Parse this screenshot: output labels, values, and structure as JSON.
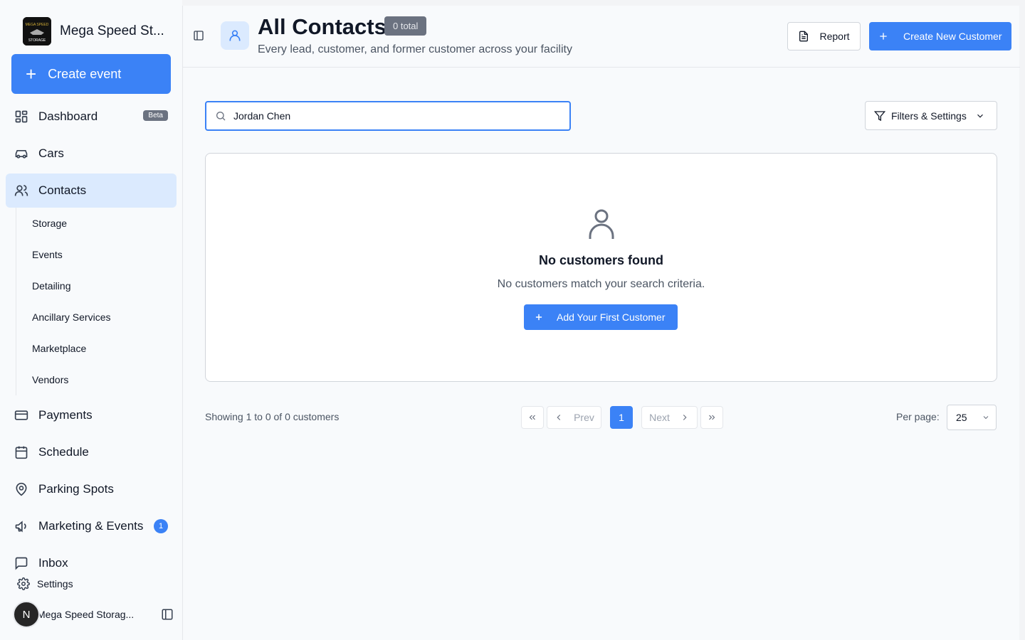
{
  "sidebar": {
    "brand_name": "Mega Speed St...",
    "brand_logo_text": "MEGA SPEED STORAGE",
    "create_event_label": "Create event",
    "nav": {
      "dashboard": "Dashboard",
      "dashboard_badge": "Beta",
      "cars": "Cars",
      "contacts": "Contacts",
      "payments": "Payments",
      "schedule": "Schedule",
      "parking_spots": "Parking Spots",
      "marketing_events": "Marketing & Events",
      "marketing_count": "1",
      "inbox": "Inbox"
    },
    "sub_items": [
      "Storage",
      "Events",
      "Detailing",
      "Ancillary Services",
      "Marketplace",
      "Vendors"
    ],
    "settings_label": "Settings",
    "user_initial": "N",
    "user_name": "Mega Speed Storag..."
  },
  "header": {
    "title": "All Contacts",
    "total_badge": "0 total",
    "subtitle": "Every lead, customer, and former customer across your facility",
    "report_label": "Report",
    "create_customer_label": "Create New Customer"
  },
  "search": {
    "value": "Jordan Chen",
    "placeholder": ""
  },
  "filters_label": "Filters & Settings",
  "empty_state": {
    "title": "No customers found",
    "subtitle": "No customers match your search criteria.",
    "button_label": "Add Your First Customer"
  },
  "pagination": {
    "showing_text": "Showing 1 to 0 of 0 customers",
    "prev_label": "Prev",
    "next_label": "Next",
    "current_page": "1",
    "per_page_label": "Per page:",
    "per_page_value": "25"
  },
  "colors": {
    "accent": "#3b82f6",
    "active_nav_bg": "#dbeafe",
    "badge_gray": "#6b7280"
  }
}
